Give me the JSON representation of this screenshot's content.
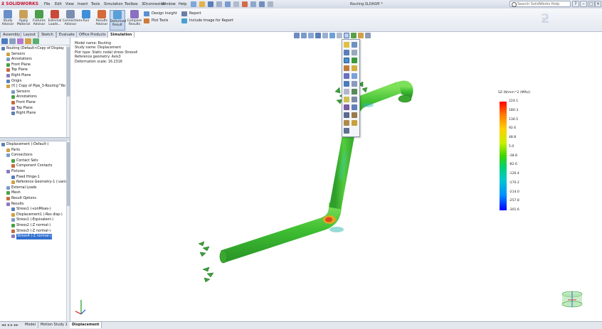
{
  "app": {
    "logo": "SOLIDWORKS",
    "document_title": "Routing.SLDASM *"
  },
  "menu": [
    "File",
    "Edit",
    "View",
    "Insert",
    "Tools",
    "Simulation",
    "Toolbox",
    "3Dconnexion",
    "Window",
    "Help"
  ],
  "search": {
    "placeholder": "Search SolidWorks Help"
  },
  "window_buttons": [
    "?",
    "–",
    "□",
    "×"
  ],
  "command_manager": {
    "tools": [
      {
        "label": "Study Advisor"
      },
      {
        "label": "Apply Material"
      },
      {
        "label": "Fixtures Advisor"
      },
      {
        "label": "External Loads..."
      },
      {
        "label": "Connections Advisor"
      },
      {
        "label": "Run"
      },
      {
        "label": "Results Advisor"
      },
      {
        "label": "Deformed Result"
      },
      {
        "label": "Compare Results"
      }
    ],
    "small_tools": [
      "Design Insight",
      "Plot Tools",
      "Report",
      "Include Image for Report"
    ]
  },
  "tabs": [
    "Assembly",
    "Layout",
    "Sketch",
    "Evaluate",
    "Office Products",
    "Simulation"
  ],
  "active_tab": "Simulation",
  "feature_tree": [
    {
      "label": "Routing  (Default<Copy of Display",
      "indent": 0
    },
    {
      "label": "Sensors",
      "indent": 1
    },
    {
      "label": "Annotations",
      "indent": 1
    },
    {
      "label": "Front Plane",
      "indent": 1
    },
    {
      "label": "Top Plane",
      "indent": 1
    },
    {
      "label": "Right Plane",
      "indent": 1
    },
    {
      "label": "Origin",
      "indent": 1
    },
    {
      "label": "(f) [ Copy of Pipe_3-Routing^Ro",
      "indent": 1
    },
    {
      "label": "Sensors",
      "indent": 2
    },
    {
      "label": "Annotations",
      "indent": 2
    },
    {
      "label": "Front Plane",
      "indent": 2
    },
    {
      "label": "Top Plane",
      "indent": 2
    },
    {
      "label": "Right Plane",
      "indent": 2
    }
  ],
  "study_tree": [
    {
      "label": "Displacement (-Default-)",
      "indent": 0
    },
    {
      "label": "Parts",
      "indent": 1
    },
    {
      "label": "Connections",
      "indent": 1
    },
    {
      "label": "Contact Sets",
      "indent": 2
    },
    {
      "label": "Component Contacts",
      "indent": 2
    },
    {
      "label": "Fixtures",
      "indent": 1
    },
    {
      "label": "Fixed Hinge-1",
      "indent": 2
    },
    {
      "label": "Reference Geometry-1 (:variab",
      "indent": 2
    },
    {
      "label": "External Loads",
      "indent": 1
    },
    {
      "label": "Mesh",
      "indent": 1
    },
    {
      "label": "Result Options",
      "indent": 1
    },
    {
      "label": "Results",
      "indent": 1
    },
    {
      "label": "Stress1 (-vonMises-)",
      "indent": 2
    },
    {
      "label": "Displacement1 (-Res disp-)",
      "indent": 2
    },
    {
      "label": "Stress1 (-Equivalent-)",
      "indent": 2
    },
    {
      "label": "Stress2 (-Z normal-)",
      "indent": 2
    },
    {
      "label": "Stress3 (-Z normal-)",
      "indent": 2
    },
    {
      "label": "Stress4 (-Z normal-)",
      "indent": 2,
      "selected": true
    }
  ],
  "plot_info": {
    "model_name": "Model name: Routing",
    "study_name": "Study name: Displacement",
    "plot_type": "Plot type: Static nodal stress Stress4",
    "reference_geometry": "Reference geometry: Axis3",
    "deformation_scale": "Deformation scale: 16.2316"
  },
  "legend": {
    "title": "SZ (N/mm^2 (MPa))",
    "values": [
      "224.1",
      "180.3",
      "136.5",
      "92.6",
      "48.8",
      "5.0",
      "-38.8",
      "-82.6",
      "-126.4",
      "-170.2",
      "-214.0",
      "-257.8",
      "-301.6"
    ]
  },
  "bottom_tabs": [
    "Model",
    "Motion Study 1",
    "Displacement"
  ],
  "active_bottom_tab": "Displacement",
  "colors": {
    "accent": "#3070d0",
    "brand": "#c8102e",
    "pipe_green": "#4ec83a"
  }
}
